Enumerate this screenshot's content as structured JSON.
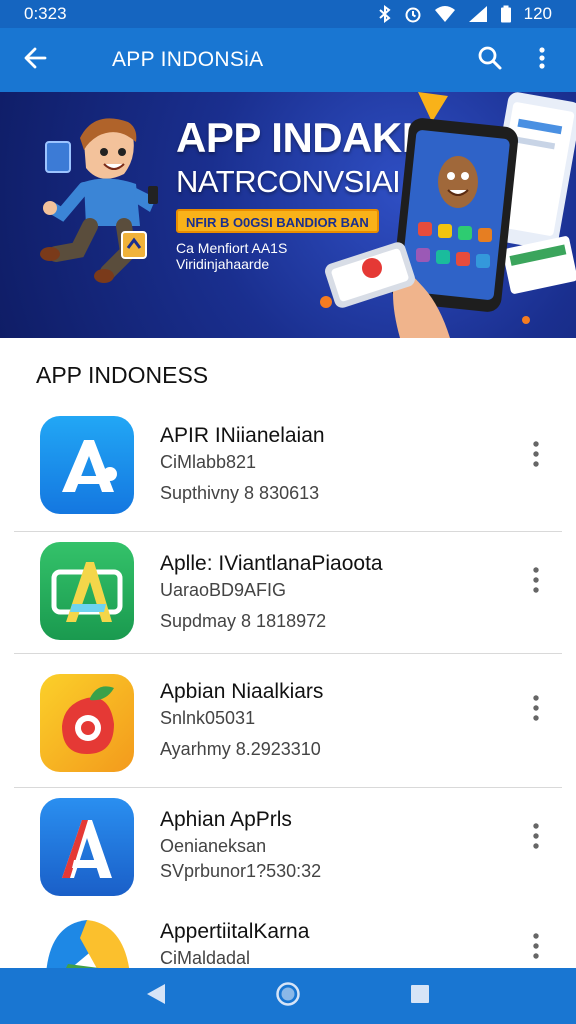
{
  "status_bar": {
    "time": "0:323",
    "battery_text": "120",
    "icons": [
      "bluetooth-icon",
      "alarm-icon",
      "wifi-icon",
      "signal-icon",
      "battery-icon"
    ]
  },
  "app_bar": {
    "title": "APP INDONSiA",
    "icons": [
      "arrow-back-icon",
      "search-icon",
      "more-vert-icon"
    ]
  },
  "banner": {
    "headline": "APP INDAKIA",
    "subheadline": "NATRCONVSIAI",
    "tag": "NFIR B O0GSI BANDIOR BAN",
    "line1": "Ca Menfiort AA1S",
    "line2": "Viridinjahaarde",
    "colors": {
      "accent": "#f9b219",
      "background": "#1a2f8f"
    }
  },
  "section": {
    "heading": "APP INDONESS"
  },
  "apps": [
    {
      "name": "APIR INiianelaian",
      "developer": "CiMlabb821",
      "meta": "Supthivny 8 830613",
      "icon": "app-a-blue-icon"
    },
    {
      "name": "Aplle: IViantlanaPiaoota",
      "developer": "UaraoBD9AFIG",
      "meta": "Supdmay 8 1818972",
      "icon": "app-a-green-icon"
    },
    {
      "name": "Apbian Niaalkiars",
      "developer": "Snlnk05031",
      "meta": "Ayarhmy 8.2923310",
      "icon": "app-fruit-icon"
    },
    {
      "name": "Aphian ApPrls",
      "developer": "Oenianeksan",
      "meta": "SVprbunor1?530:32",
      "icon": "app-a-colorful-icon"
    },
    {
      "name": "AppertiitalKarna",
      "developer": "CiMaldadal",
      "meta": "",
      "icon": "app-drive-icon"
    }
  ],
  "nav_bar": {
    "icons": [
      "nav-back-icon",
      "nav-home-icon",
      "nav-recents-icon"
    ]
  }
}
